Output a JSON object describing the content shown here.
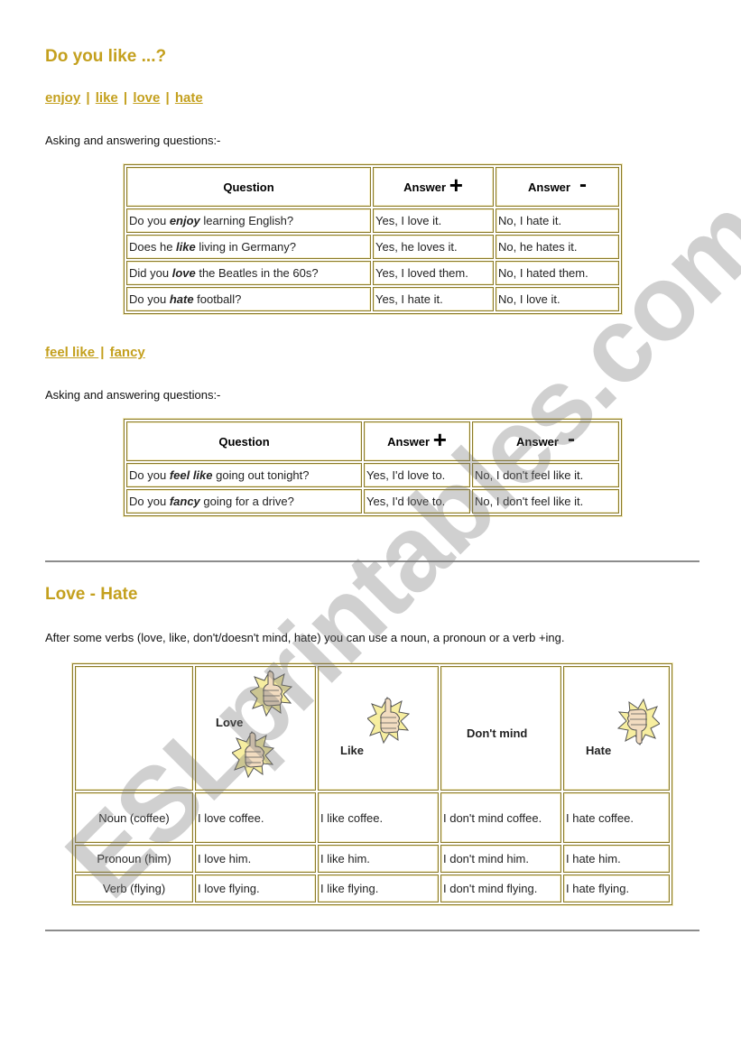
{
  "section1": {
    "title": "Do you like ...?",
    "links": [
      "enjoy",
      "like",
      "love",
      "hate"
    ],
    "intro": "Asking and answering questions:-",
    "table": {
      "headers": {
        "question": "Question",
        "answer_pos": "Answer",
        "answer_neg": "Answer",
        "plus": "+",
        "minus": "-"
      },
      "rows": [
        {
          "pre": "Do you ",
          "verb": "enjoy",
          "post": " learning English?",
          "pos": "Yes, I love it.",
          "neg": "No, I hate it."
        },
        {
          "pre": "Does he ",
          "verb": "like",
          "post": " living in Germany?",
          "pos": "Yes, he loves it.",
          "neg": "No, he hates it."
        },
        {
          "pre": "Did you ",
          "verb": "love",
          "post": " the Beatles in the 60s?",
          "pos": "Yes, I loved them.",
          "neg": "No, I hated them."
        },
        {
          "pre": "Do you ",
          "verb": "hate",
          "post": " football?",
          "pos": "Yes, I hate it.",
          "neg": "No, I love it."
        }
      ]
    }
  },
  "section2": {
    "links": [
      "feel like ",
      "fancy"
    ],
    "intro": "Asking and answering questions:-",
    "table": {
      "headers": {
        "question": "Question",
        "answer_pos": "Answer",
        "answer_neg": "Answer",
        "plus": "+",
        "minus": "-"
      },
      "rows": [
        {
          "pre": "Do you ",
          "verb": "feel like",
          "post": " going out tonight?",
          "pos": "Yes, I'd love to.",
          "neg": "No, I don't feel like it."
        },
        {
          "pre": "Do you ",
          "verb": "fancy",
          "post": " going for a drive?",
          "pos": "Yes, I'd love to.",
          "neg": "No, I don't feel like it."
        }
      ]
    }
  },
  "section3": {
    "title": "Love - Hate",
    "intro": "After some verbs (love, like, don't/doesn't mind, hate) you can use a noun, a pronoun or a verb +ing.",
    "columns": [
      {
        "label": "Love",
        "icon": "thumbs-up-double-icon"
      },
      {
        "label": "Like",
        "icon": "thumbs-up-icon"
      },
      {
        "label": "Don't mind",
        "icon": ""
      },
      {
        "label": "Hate",
        "icon": "thumbs-down-icon"
      }
    ],
    "rows": [
      {
        "head": "Noun (coffee)",
        "cells": [
          "I love coffee.",
          "I like coffee.",
          "I don't mind coffee.",
          "I hate coffee."
        ]
      },
      {
        "head": "Pronoun (him)",
        "cells": [
          "I love him.",
          "I like him.",
          "I don't mind him.",
          "I hate him."
        ]
      },
      {
        "head": "Verb (flying)",
        "cells": [
          "I love flying.",
          "I like flying.",
          "I don't mind flying.",
          "I hate flying."
        ]
      }
    ]
  },
  "watermark": "ESLprintables.com",
  "colors": {
    "accent": "#c4a01e",
    "table_border": "#8a7a2a",
    "rule": "#8c8c8c"
  }
}
